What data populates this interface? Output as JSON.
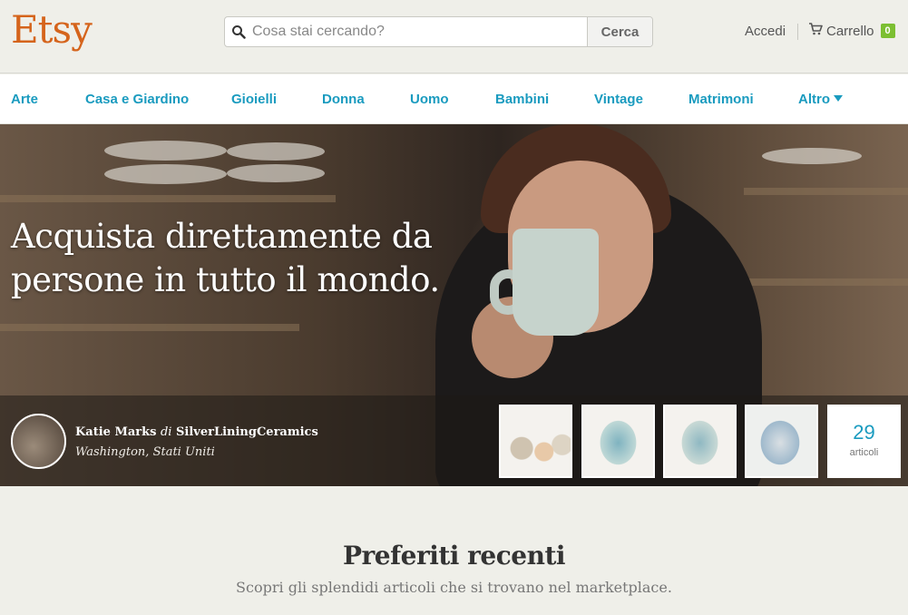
{
  "header": {
    "logo": "Etsy",
    "search_placeholder": "Cosa stai cercando?",
    "search_button": "Cerca",
    "signin": "Accedi",
    "cart_label": "Carrello",
    "cart_count": "0"
  },
  "categories": [
    {
      "label": "Arte"
    },
    {
      "label": "Casa e Giardino"
    },
    {
      "label": "Gioielli"
    },
    {
      "label": "Donna"
    },
    {
      "label": "Uomo"
    },
    {
      "label": "Bambini"
    },
    {
      "label": "Vintage"
    },
    {
      "label": "Matrimoni"
    },
    {
      "label": "Altro",
      "has_caret": true
    }
  ],
  "hero": {
    "title": "Acquista direttamente da persone in tutto il mondo.",
    "seller_name": "Katie Marks",
    "seller_connector": "di",
    "shop_name": "SilverLiningCeramics",
    "location": "Washington, Stati Uniti",
    "item_count": "29",
    "item_count_label": "articoli"
  },
  "favorites": {
    "title": "Preferiti recenti",
    "subtitle": "Scopri gli splendidi articoli che si trovano nel marketplace."
  },
  "colors": {
    "brand_orange": "#d5641c",
    "link_blue": "#1a9bbf",
    "cart_badge_green": "#7cbf32",
    "background": "#efefe9"
  }
}
